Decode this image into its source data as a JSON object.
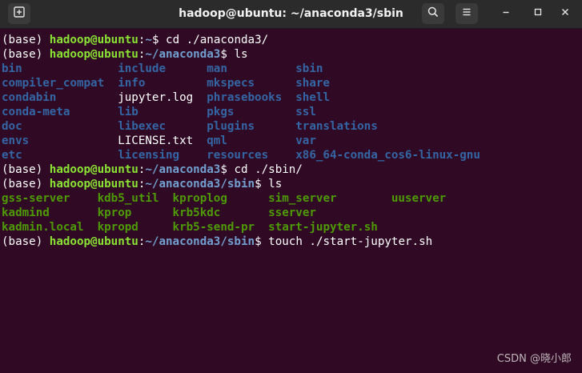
{
  "window": {
    "title": "hadoop@ubuntu: ~/anaconda3/sbin"
  },
  "icons": {
    "new_tab": "new-tab-icon",
    "search": "search-icon",
    "menu": "hamburger-menu-icon",
    "minimize": "minimize-icon",
    "maximize": "maximize-icon",
    "close": "close-icon"
  },
  "colors": {
    "terminal_bg": "#300a24",
    "prompt_user": "#8ae234",
    "prompt_path": "#729fcf",
    "dir_color": "#3465a4",
    "exec_color": "#4e9a06"
  },
  "terminal": {
    "lines": [
      {
        "env": "(base) ",
        "user": "hadoop@ubuntu",
        "colon": ":",
        "path": "~",
        "sym": "$ ",
        "cmd": "cd ./anaconda3/"
      },
      {
        "env": "(base) ",
        "user": "hadoop@ubuntu",
        "colon": ":",
        "path": "~/anaconda3",
        "sym": "$ ",
        "cmd": "ls"
      }
    ],
    "ls1": [
      [
        "bin",
        "include",
        "man",
        "sbin"
      ],
      [
        "compiler_compat",
        "info",
        "mkspecs",
        "share"
      ],
      [
        "condabin",
        "jupyter.log",
        "phrasebooks",
        "shell"
      ],
      [
        "conda-meta",
        "lib",
        "pkgs",
        "ssl"
      ],
      [
        "doc",
        "libexec",
        "plugins",
        "translations"
      ],
      [
        "envs",
        "LICENSE.txt",
        "qml",
        "var"
      ],
      [
        "etc",
        "licensing",
        "resources",
        "x86_64-conda_cos6-linux-gnu"
      ]
    ],
    "lines2": [
      {
        "env": "(base) ",
        "user": "hadoop@ubuntu",
        "colon": ":",
        "path": "~/anaconda3",
        "sym": "$ ",
        "cmd": "cd ./sbin/"
      },
      {
        "env": "(base) ",
        "user": "hadoop@ubuntu",
        "colon": ":",
        "path": "~/anaconda3/sbin",
        "sym": "$ ",
        "cmd": "ls"
      }
    ],
    "ls2": [
      [
        "gss-server",
        "kdb5_util",
        "kproplog",
        "sim_server",
        "uuserver"
      ],
      [
        "kadmind",
        "kprop",
        "krb5kdc",
        "sserver",
        ""
      ],
      [
        "kadmin.local",
        "kpropd",
        "krb5-send-pr",
        "start-jupyter.sh",
        ""
      ]
    ],
    "lines3": [
      {
        "env": "(base) ",
        "user": "hadoop@ubuntu",
        "colon": ":",
        "path": "~/anaconda3/sbin",
        "sym": "$ ",
        "cmd": "touch ./start-jupyter.sh"
      }
    ]
  },
  "watermark": "CSDN @晓小郎"
}
